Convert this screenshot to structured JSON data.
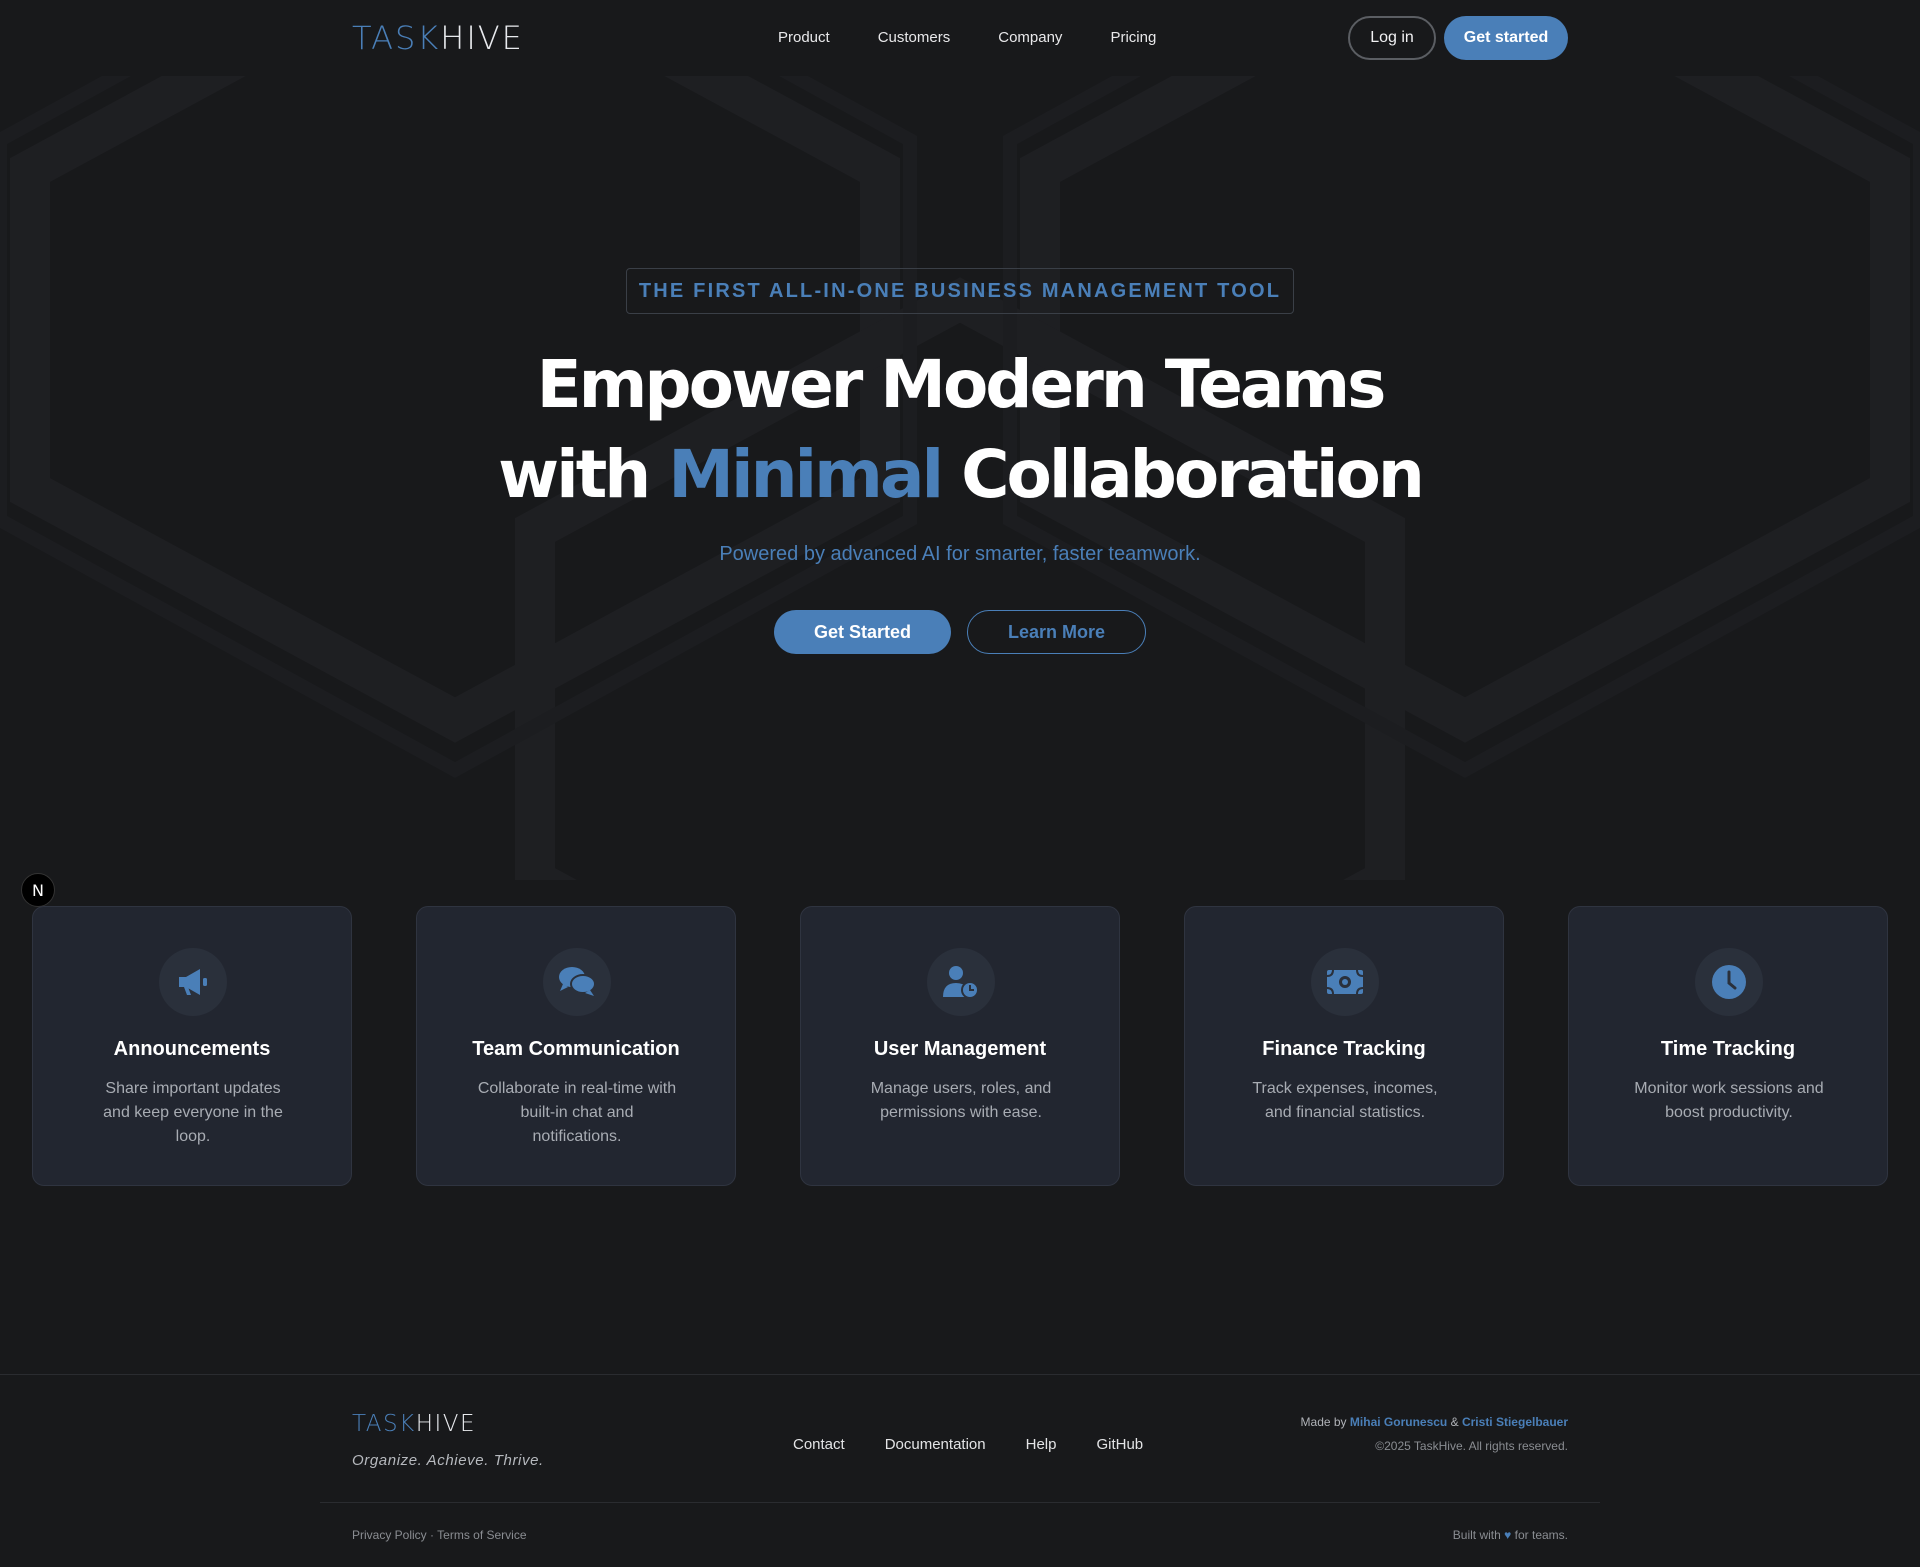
{
  "colors": {
    "accent": "#4a7fb8",
    "background": "#18191b",
    "card": "#222630"
  },
  "header": {
    "logo_part1": "TASK",
    "logo_part2": "HIVE",
    "nav": [
      "Product",
      "Customers",
      "Company",
      "Pricing"
    ],
    "login_label": "Log in",
    "get_started_label": "Get started"
  },
  "hero": {
    "tagline": "THE FIRST ALL-IN-ONE BUSINESS MANAGEMENT TOOL",
    "headline_line1": "Empower Modern Teams",
    "headline_line2_pre": "with ",
    "headline_line2_accent": "Minimal",
    "headline_line2_post": " Collaboration",
    "subtitle": "Powered by advanced AI for smarter, faster teamwork.",
    "primary_cta": "Get Started",
    "secondary_cta": "Learn More"
  },
  "badge": {
    "letter": "N"
  },
  "features": [
    {
      "icon": "megaphone-icon",
      "title": "Announcements",
      "description": "Share important updates and keep everyone in the loop."
    },
    {
      "icon": "chat-bubbles-icon",
      "title": "Team Communication",
      "description": "Collaborate in real-time with built-in chat and notifications."
    },
    {
      "icon": "user-clock-icon",
      "title": "User Management",
      "description": "Manage users, roles, and permissions with ease."
    },
    {
      "icon": "money-bill-icon",
      "title": "Finance Tracking",
      "description": "Track expenses, incomes, and financial statistics."
    },
    {
      "icon": "clock-icon",
      "title": "Time Tracking",
      "description": "Monitor work sessions and boost productivity."
    }
  ],
  "footer": {
    "logo_part1": "TASK",
    "logo_part2": "HIVE",
    "slogan": "Organize. Achieve. Thrive.",
    "nav": [
      "Contact",
      "Documentation",
      "Help",
      "GitHub"
    ],
    "made_by_prefix": "Made by",
    "author1": "Mihai Gorunescu",
    "ampersand": "&",
    "author2": "Cristi Stiegelbauer",
    "copyright": "©2025 TaskHive. All rights reserved.",
    "privacy": "Privacy Policy",
    "separator": "·",
    "terms": "Terms of Service",
    "built_prefix": "Built with",
    "heart": "♥",
    "built_suffix": "for teams."
  }
}
